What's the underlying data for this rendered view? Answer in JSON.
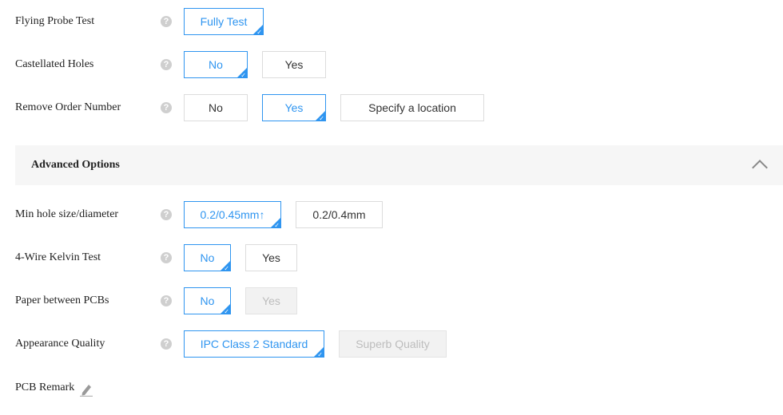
{
  "help_glyph": "?",
  "rows": {
    "flying_probe": {
      "label": "Flying Probe Test",
      "options": [
        "Fully Test"
      ],
      "selected": "Fully Test"
    },
    "castellated": {
      "label": "Castellated Holes",
      "options": [
        "No",
        "Yes"
      ],
      "selected": "No"
    },
    "remove_order": {
      "label": "Remove Order Number",
      "options": [
        "No",
        "Yes",
        "Specify a location"
      ],
      "selected": "Yes"
    },
    "min_hole": {
      "label": "Min hole size/diameter",
      "options": [
        "0.2/0.45mm↑",
        "0.2/0.4mm"
      ],
      "selected": "0.2/0.45mm↑"
    },
    "kelvin": {
      "label": "4-Wire Kelvin Test",
      "options": [
        "No",
        "Yes"
      ],
      "selected": "No"
    },
    "paper": {
      "label": "Paper between PCBs",
      "options": [
        "No",
        "Yes"
      ],
      "selected": "No",
      "disabled": [
        "Yes"
      ]
    },
    "appearance": {
      "label": "Appearance Quality",
      "options": [
        "IPC Class 2 Standard",
        "Superb Quality"
      ],
      "selected": "IPC Class 2 Standard",
      "disabled": [
        "Superb Quality"
      ]
    }
  },
  "advanced": {
    "title": "Advanced Options",
    "expanded": true,
    "icon": "chevron-up-icon"
  },
  "remark": {
    "label": "PCB Remark",
    "icon": "pencil-icon"
  },
  "colors": {
    "accent": "#2f95f0",
    "border": "#dcdcdc",
    "disabled_bg": "#f2f2f2",
    "section_bg": "#f6f6f6"
  }
}
